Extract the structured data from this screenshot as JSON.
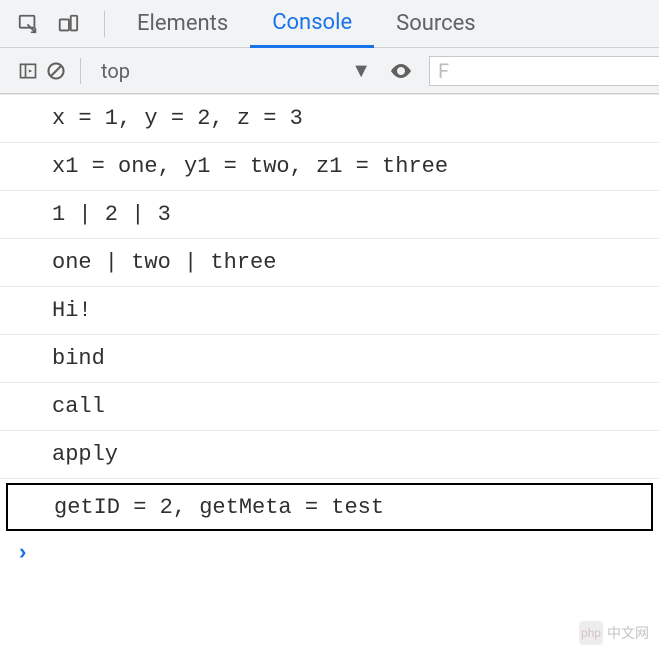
{
  "tabs": {
    "elements": "Elements",
    "console": "Console",
    "sources": "Sources",
    "active": "console"
  },
  "toolbar": {
    "context": "top",
    "filter_placeholder": "F"
  },
  "logs": [
    {
      "text": "x = 1, y = 2, z = 3",
      "highlight": false
    },
    {
      "text": "x1 = one, y1 = two, z1 = three",
      "highlight": false
    },
    {
      "text": "1 | 2 | 3",
      "highlight": false
    },
    {
      "text": "one | two | three",
      "highlight": false
    },
    {
      "text": "Hi!",
      "highlight": false
    },
    {
      "text": "bind",
      "highlight": false
    },
    {
      "text": "call",
      "highlight": false
    },
    {
      "text": "apply",
      "highlight": false
    },
    {
      "text": "getID = 2, getMeta = test",
      "highlight": true
    }
  ],
  "watermark": {
    "logo": "php",
    "text": "中文网"
  }
}
